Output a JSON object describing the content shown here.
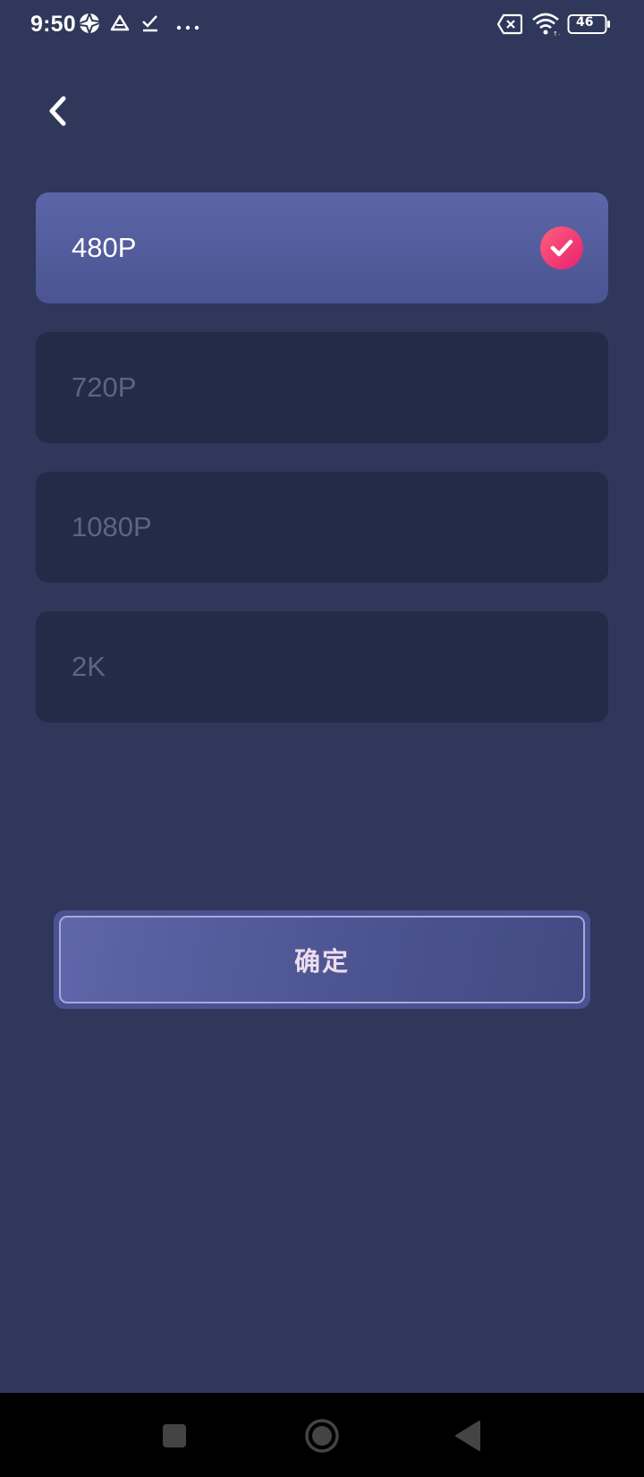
{
  "status_bar": {
    "time": "9:50",
    "battery": "46",
    "icons": [
      "aperture-icon",
      "drive-icon",
      "download-done-icon",
      "more-dots-icon",
      "sim-error-icon",
      "wifi-icon",
      "battery-icon"
    ]
  },
  "header": {
    "back_icon": "chevron-left-icon"
  },
  "options": [
    {
      "label": "480P",
      "selected": true
    },
    {
      "label": "720P",
      "selected": false
    },
    {
      "label": "1080P",
      "selected": false
    },
    {
      "label": "2K",
      "selected": false
    }
  ],
  "confirm": {
    "label": "确定"
  },
  "nav_bar": {
    "icons": [
      "recents-square-icon",
      "home-circle-icon",
      "back-triangle-icon"
    ]
  },
  "colors": {
    "background": "#2f375a",
    "option_bg": "#232b48",
    "option_selected_bg": "#5860a2",
    "option_text": "#5c6488",
    "check_badge": "#f23a78",
    "confirm_text": "#ecdcec"
  }
}
